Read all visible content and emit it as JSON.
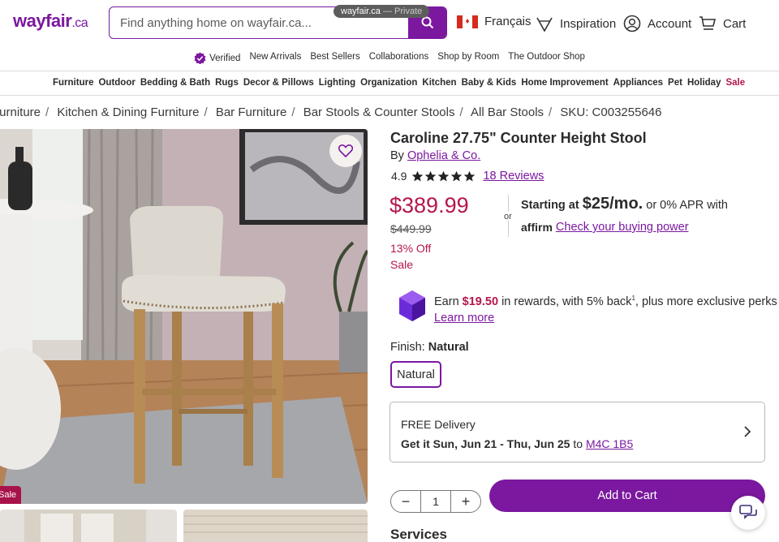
{
  "browser": {
    "private_pill": "wayfair.ca",
    "private_suffix": " — Private"
  },
  "header": {
    "logo": "wayfair",
    "logo_tld": ".ca",
    "search_placeholder": "Find anything home on wayfair.ca...",
    "language": "Français",
    "inspiration": "Inspiration",
    "account": "Account",
    "cart": "Cart"
  },
  "verified_nav": [
    "Verified",
    "New Arrivals",
    "Best Sellers",
    "Collaborations",
    "Shop by Room",
    "The Outdoor Shop"
  ],
  "categories": [
    "Furniture",
    "Outdoor",
    "Bedding & Bath",
    "Rugs",
    "Decor & Pillows",
    "Lighting",
    "Organization",
    "Kitchen",
    "Baby & Kids",
    "Home Improvement",
    "Appliances",
    "Pet",
    "Holiday",
    "Sale"
  ],
  "breadcrumb": [
    "Furniture",
    "Kitchen & Dining Furniture",
    "Bar Furniture",
    "Bar Stools & Counter Stools",
    "All Bar Stools",
    "SKU: C003255646"
  ],
  "product": {
    "title": "Caroline 27.75\" Counter Height Stool",
    "by_label": "By",
    "brand": "Ophelia & Co.",
    "rating": "4.9",
    "stars": 5,
    "reviews": "18 Reviews",
    "price": "$389.99",
    "was_price": "$449.99",
    "discount": "13% Off",
    "sale_label": "Sale",
    "image_sale_tag": "Sale"
  },
  "financing": {
    "or": "or",
    "starting_label": "Starting at",
    "monthly": "$25/mo.",
    "apr_text": "or 0% APR with",
    "affirm": "affirm",
    "check_link": "Check your buying power"
  },
  "rewards": {
    "earn": "Earn",
    "amount": "$19.50",
    "text_a": "in rewards, with 5% back",
    "sup": "1",
    "text_b": ", plus more exclusive perks",
    "learn_more": "Learn more"
  },
  "finish": {
    "label": "Finish:",
    "value": "Natural",
    "option": "Natural"
  },
  "delivery": {
    "line1": "FREE Delivery",
    "line2": "Get it Sun, Jun 21 - Thu, Jun 25",
    "to": "to",
    "postal": "M4C 1B5"
  },
  "quantity": {
    "value": "1",
    "minus": "−",
    "plus": "+"
  },
  "add_to_cart": "Add to Cart",
  "services_heading": "Services",
  "colors": {
    "brand": "#7b189f",
    "sale": "#b4174a"
  }
}
